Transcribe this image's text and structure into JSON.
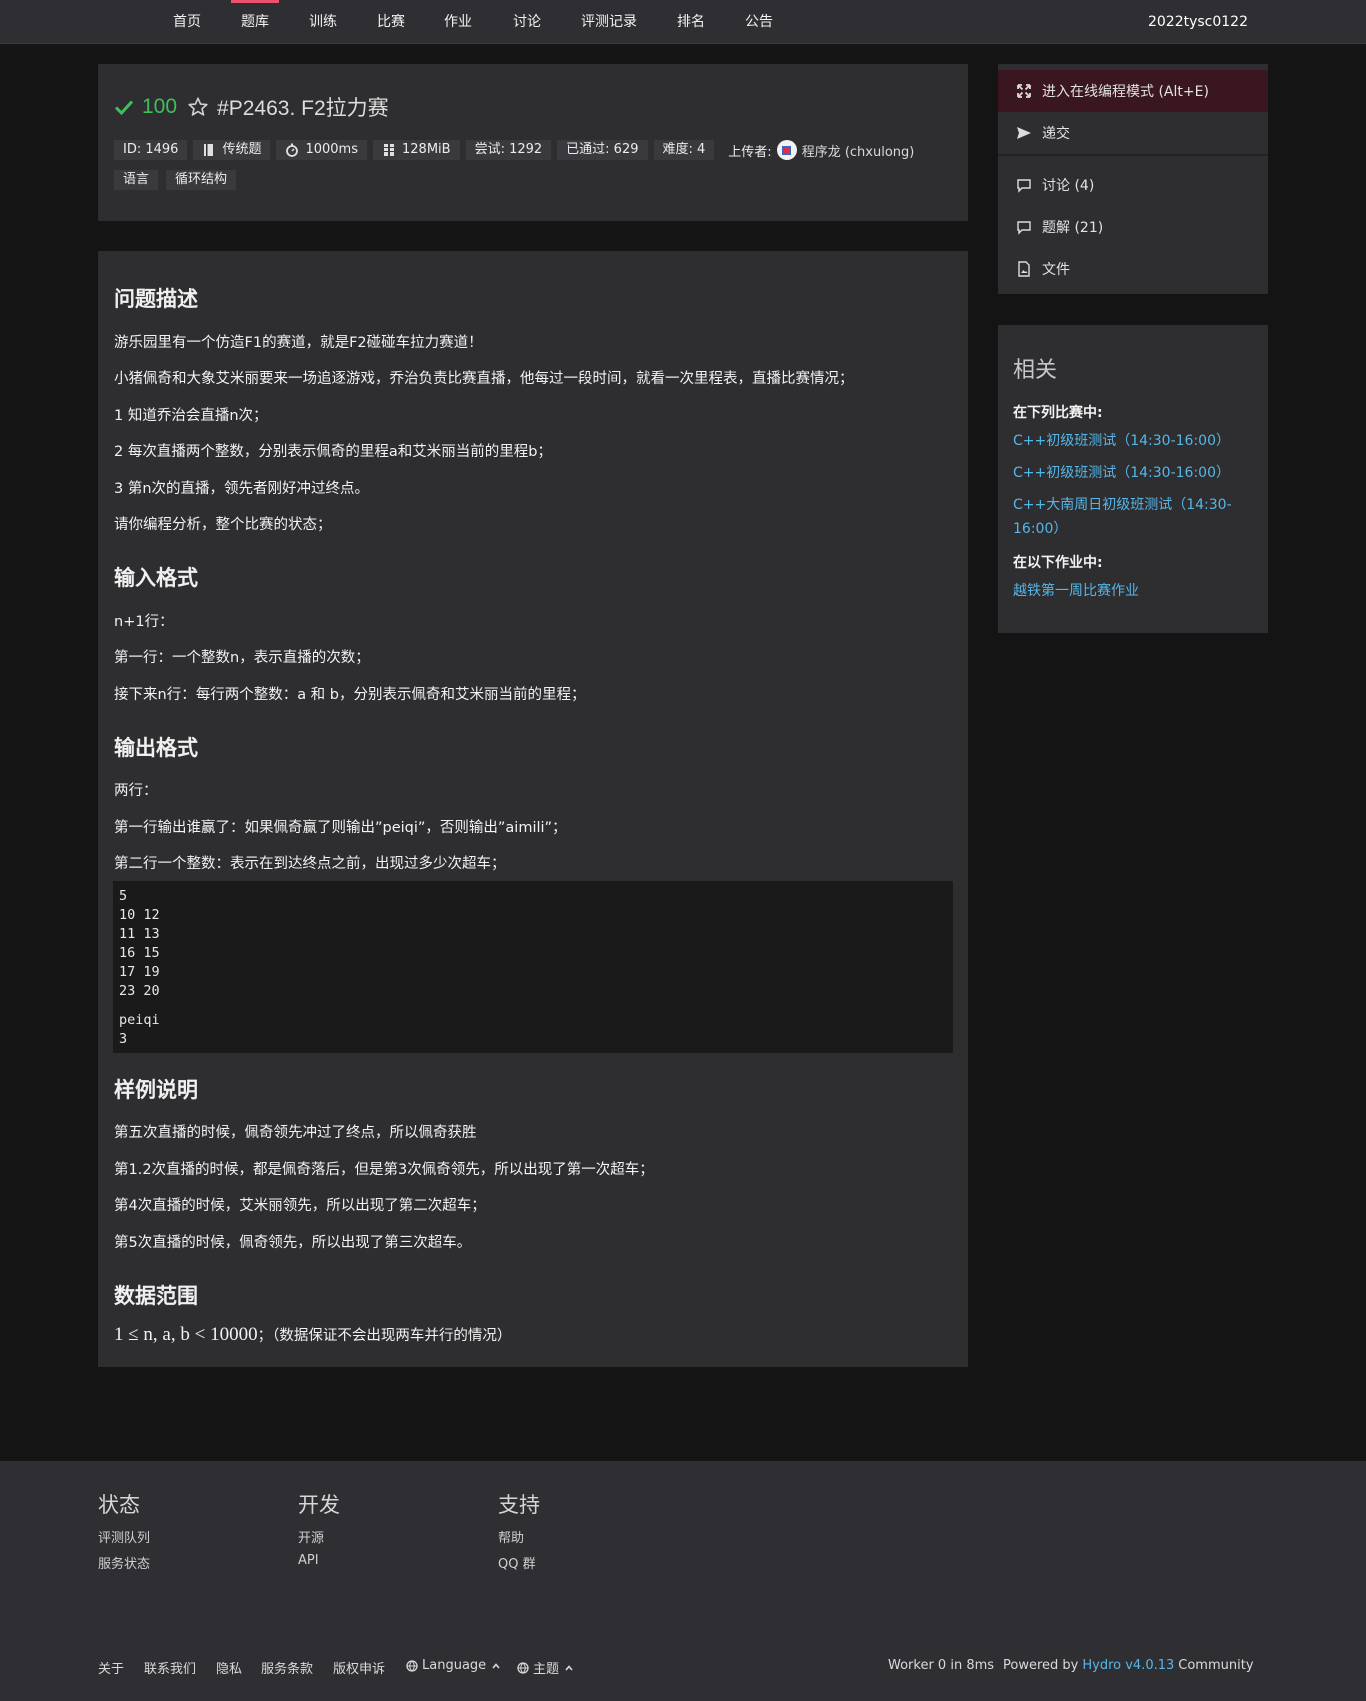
{
  "nav": {
    "items": [
      "首页",
      "题库",
      "训练",
      "比赛",
      "作业",
      "讨论",
      "评测记录",
      "排名",
      "公告"
    ],
    "user": "2022tysc0122"
  },
  "problem": {
    "score": "100",
    "title": "#P2463. F2拉力赛",
    "meta": {
      "id": "ID: 1496",
      "type": "传统题",
      "time": "1000ms",
      "memory": "128MiB",
      "tried": "尝试: 1292",
      "passed": "已通过: 629",
      "difficulty": "难度: 4",
      "uploader_label": "上传者:",
      "uploader": "程序龙 (chxulong)"
    },
    "tags": [
      "语言",
      "循环结构"
    ]
  },
  "content": {
    "desc_title": "问题描述",
    "desc": [
      "游乐园里有一个仿造F1的赛道，就是F2碰碰车拉力赛道！",
      "小猪佩奇和大象艾米丽要来一场追逐游戏，乔治负责比赛直播，他每过一段时间，就看一次里程表，直播比赛情况；",
      "1 知道乔治会直播n次；",
      "2 每次直播两个整数，分别表示佩奇的里程a和艾米丽当前的里程b；",
      "3 第n次的直播，领先者刚好冲过终点。",
      "请你编程分析，整个比赛的状态；"
    ],
    "input_title": "输入格式",
    "input": [
      "n+1行：",
      "第一行：一个整数n，表示直播的次数；",
      "接下来n行：每行两个整数：a 和 b，分别表示佩奇和艾米丽当前的里程；"
    ],
    "output_title": "输出格式",
    "output": [
      "两行：",
      "第一行输出谁赢了：如果佩奇赢了则输出”peiqi”，否则输出”aimili”；",
      "第二行一个整数：表示在到达终点之前，出现过多少次超车；"
    ],
    "sample_input": "5\n10 12\n11 13\n16 15\n17 19\n23 20",
    "sample_output": "peiqi\n3",
    "explain_title": "样例说明",
    "explain": [
      "第五次直播的时候，佩奇领先冲过了终点，所以佩奇获胜",
      "第1.2次直播的时候，都是佩奇落后，但是第3次佩奇领先，所以出现了第一次超车；",
      "第4次直播的时候，艾米丽领先，所以出现了第二次超车；",
      "第5次直播的时候，佩奇领先，所以出现了第三次超车。"
    ],
    "range_title": "数据范围",
    "range_math": "1 ≤ n, a, b < 10000",
    "range_text": "；（数据保证不会出现两车并行的情况）"
  },
  "sidebar": {
    "actions": [
      "进入在线编程模式 (Alt+E)",
      "递交",
      "讨论 (4)",
      "题解 (21)",
      "文件"
    ],
    "related_title": "相关",
    "contests_label": "在下列比赛中:",
    "contests": [
      "C++初级班测试（14:30-16:00）",
      "C++初级班测试（14:30-16:00）",
      "C++大南周日初级班测试（14:30-16:00）"
    ],
    "homework_label": "在以下作业中:",
    "homework": [
      "越铁第一周比赛作业"
    ]
  },
  "footer": {
    "cols": [
      {
        "title": "状态",
        "links": [
          "评测队列",
          "服务状态"
        ]
      },
      {
        "title": "开发",
        "links": [
          "开源",
          "API"
        ]
      },
      {
        "title": "支持",
        "links": [
          "帮助",
          "QQ 群"
        ]
      }
    ],
    "bottom_links": [
      "关于",
      "联系我们",
      "隐私",
      "服务条款",
      "版权申诉"
    ],
    "language": "Language",
    "theme": "主题",
    "worker": "Worker 0 in 8ms",
    "powered_prefix": "Powered by",
    "powered_name": "Hydro v4.0.13",
    "powered_suffix": "Community"
  },
  "colors": {
    "accent": "#e8536b",
    "success": "#3fbf5c",
    "link": "#55b6e8"
  }
}
